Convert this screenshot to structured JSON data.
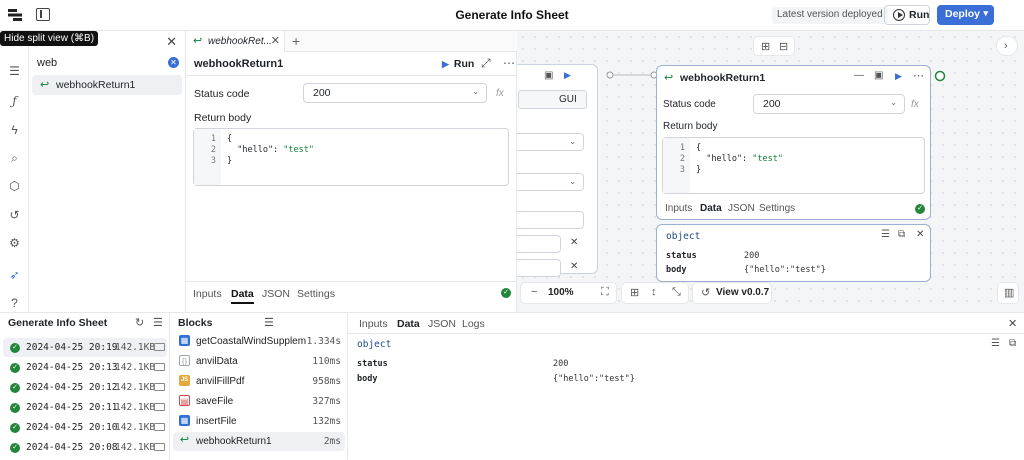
{
  "app": {
    "title": "Generate Info Sheet",
    "version_status": "Latest version deployed",
    "run_label": "Run",
    "deploy_label": "Deploy",
    "tooltip": "Hide split view (⌘B)"
  },
  "search": {
    "value": "web",
    "results": [
      {
        "label": "webhookReturn1"
      }
    ]
  },
  "editor": {
    "tab_label": "webhookRet...",
    "block_title": "webhookReturn1",
    "run_label": "Run",
    "status_code_label": "Status code",
    "status_code_value": "200",
    "fx_label": "fx",
    "return_body_label": "Return body",
    "code_lines": [
      {
        "n": "1",
        "text": "{"
      },
      {
        "n": "2",
        "key": "  \"hello\": ",
        "val": "\"test\""
      },
      {
        "n": "3",
        "text": "}"
      }
    ],
    "tabs": [
      "Inputs",
      "Data",
      "JSON",
      "Settings"
    ],
    "active_tab": "Data"
  },
  "canvas": {
    "gui_label": "GUI",
    "zoom": "100%",
    "view_version": "View v0.0.7",
    "node": {
      "title": "webhookReturn1",
      "status_code_label": "Status code",
      "status_code_value": "200",
      "fx_label": "fx",
      "return_body_label": "Return body",
      "tabs": [
        "Inputs",
        "Data",
        "JSON",
        "Settings"
      ]
    },
    "data_card": {
      "type": "object",
      "rows": [
        {
          "key": "status",
          "value": "200"
        },
        {
          "key": "body",
          "value": "{\"hello\":\"test\"}"
        }
      ]
    }
  },
  "runs": {
    "title": "Generate Info Sheet",
    "items": [
      {
        "ts": "2024-04-25 20:19",
        "size": "142.1KB"
      },
      {
        "ts": "2024-04-25 20:13",
        "size": "142.1KB"
      },
      {
        "ts": "2024-04-25 20:12",
        "size": "142.1KB"
      },
      {
        "ts": "2024-04-25 20:11",
        "size": "142.1KB"
      },
      {
        "ts": "2024-04-25 20:10",
        "size": "142.1KB"
      },
      {
        "ts": "2024-04-25 20:08",
        "size": "142.1KB"
      }
    ]
  },
  "blocks": {
    "title": "Blocks",
    "items": [
      {
        "name": "getCoastalWindSupplem...",
        "time": "1.334s",
        "icon": "table-icon",
        "color": "#2f6fd6"
      },
      {
        "name": "anvilData",
        "time": "110ms",
        "icon": "braces-icon",
        "color": "#9ca3af"
      },
      {
        "name": "anvilFillPdf",
        "time": "958ms",
        "icon": "js-icon",
        "color": "#e2a93b"
      },
      {
        "name": "saveFile",
        "time": "327ms",
        "icon": "file-icon",
        "color": "#d64545"
      },
      {
        "name": "insertFile",
        "time": "132ms",
        "icon": "table-icon",
        "color": "#2f6fd6"
      },
      {
        "name": "webhookReturn1",
        "time": "2ms",
        "icon": "webhook-icon",
        "color": "#15803d"
      }
    ]
  },
  "output": {
    "tabs": [
      "Inputs",
      "Data",
      "JSON",
      "Logs"
    ],
    "active_tab": "Data",
    "type": "object",
    "rows": [
      {
        "key": "status",
        "value": "200"
      },
      {
        "key": "body",
        "value": "{\"hello\":\"test\"}"
      }
    ]
  }
}
